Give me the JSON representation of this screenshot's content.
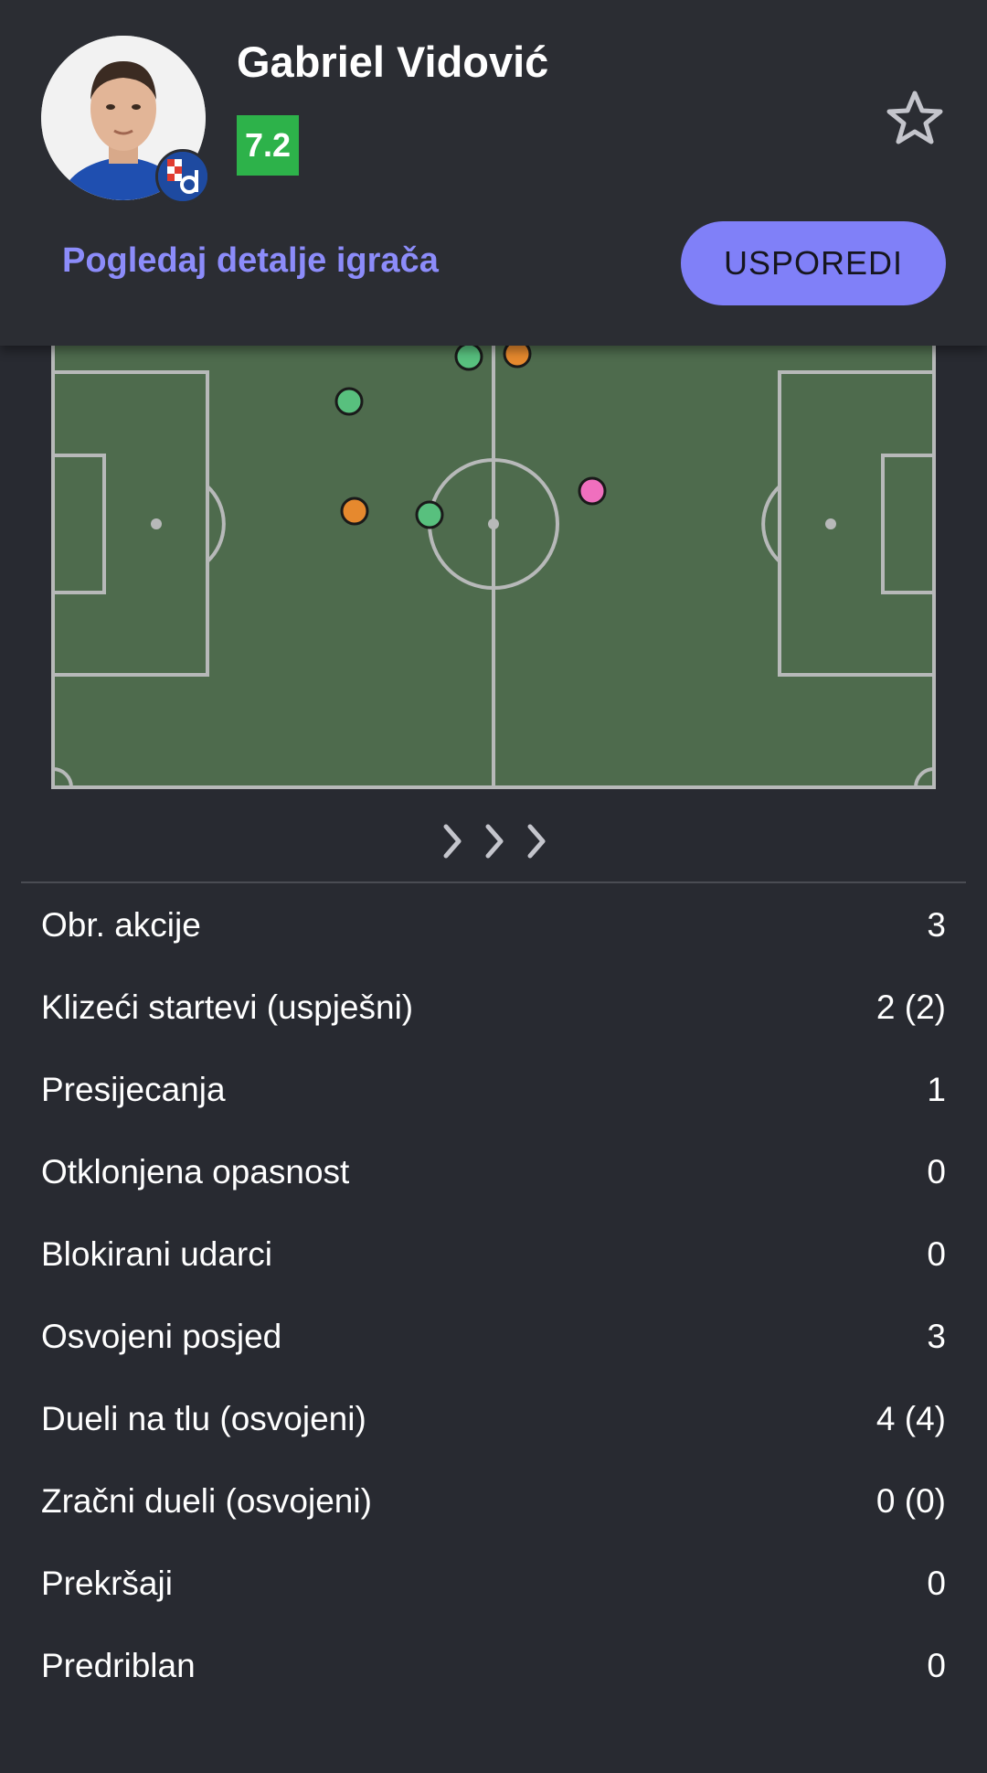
{
  "player": {
    "name": "Gabriel Vidović",
    "rating": "7.2",
    "rating_color": "#2db24a"
  },
  "icons": {
    "favorite": "star-outline-icon",
    "next": "chevron-right-icon"
  },
  "actions": {
    "details_link": "Pogledaj detalje igrača",
    "compare_button": "USPOREDI"
  },
  "pitch_map": {
    "markers": [
      {
        "color": "#58c07e"
      },
      {
        "color": "#e6892e"
      },
      {
        "color": "#58c07e"
      },
      {
        "color": "#e6892e"
      },
      {
        "color": "#58c07e"
      },
      {
        "color": "#f06fbe"
      }
    ]
  },
  "stats": [
    {
      "label": "Obr. akcije",
      "value": "3"
    },
    {
      "label": "Klizeći startevi (uspješni)",
      "value": "2 (2)"
    },
    {
      "label": "Presijecanja",
      "value": "1"
    },
    {
      "label": "Otklonjena opasnost",
      "value": "0"
    },
    {
      "label": "Blokirani udarci",
      "value": "0"
    },
    {
      "label": "Osvojeni posjed",
      "value": "3"
    },
    {
      "label": "Dueli na tlu (osvojeni)",
      "value": "4 (4)"
    },
    {
      "label": "Zračni dueli (osvojeni)",
      "value": "0 (0)"
    },
    {
      "label": "Prekršaji",
      "value": "0"
    },
    {
      "label": "Predriblan",
      "value": "0"
    }
  ],
  "colors": {
    "background": "#282a31",
    "pitch": "#4e6b4d",
    "accent": "#8080f8"
  }
}
